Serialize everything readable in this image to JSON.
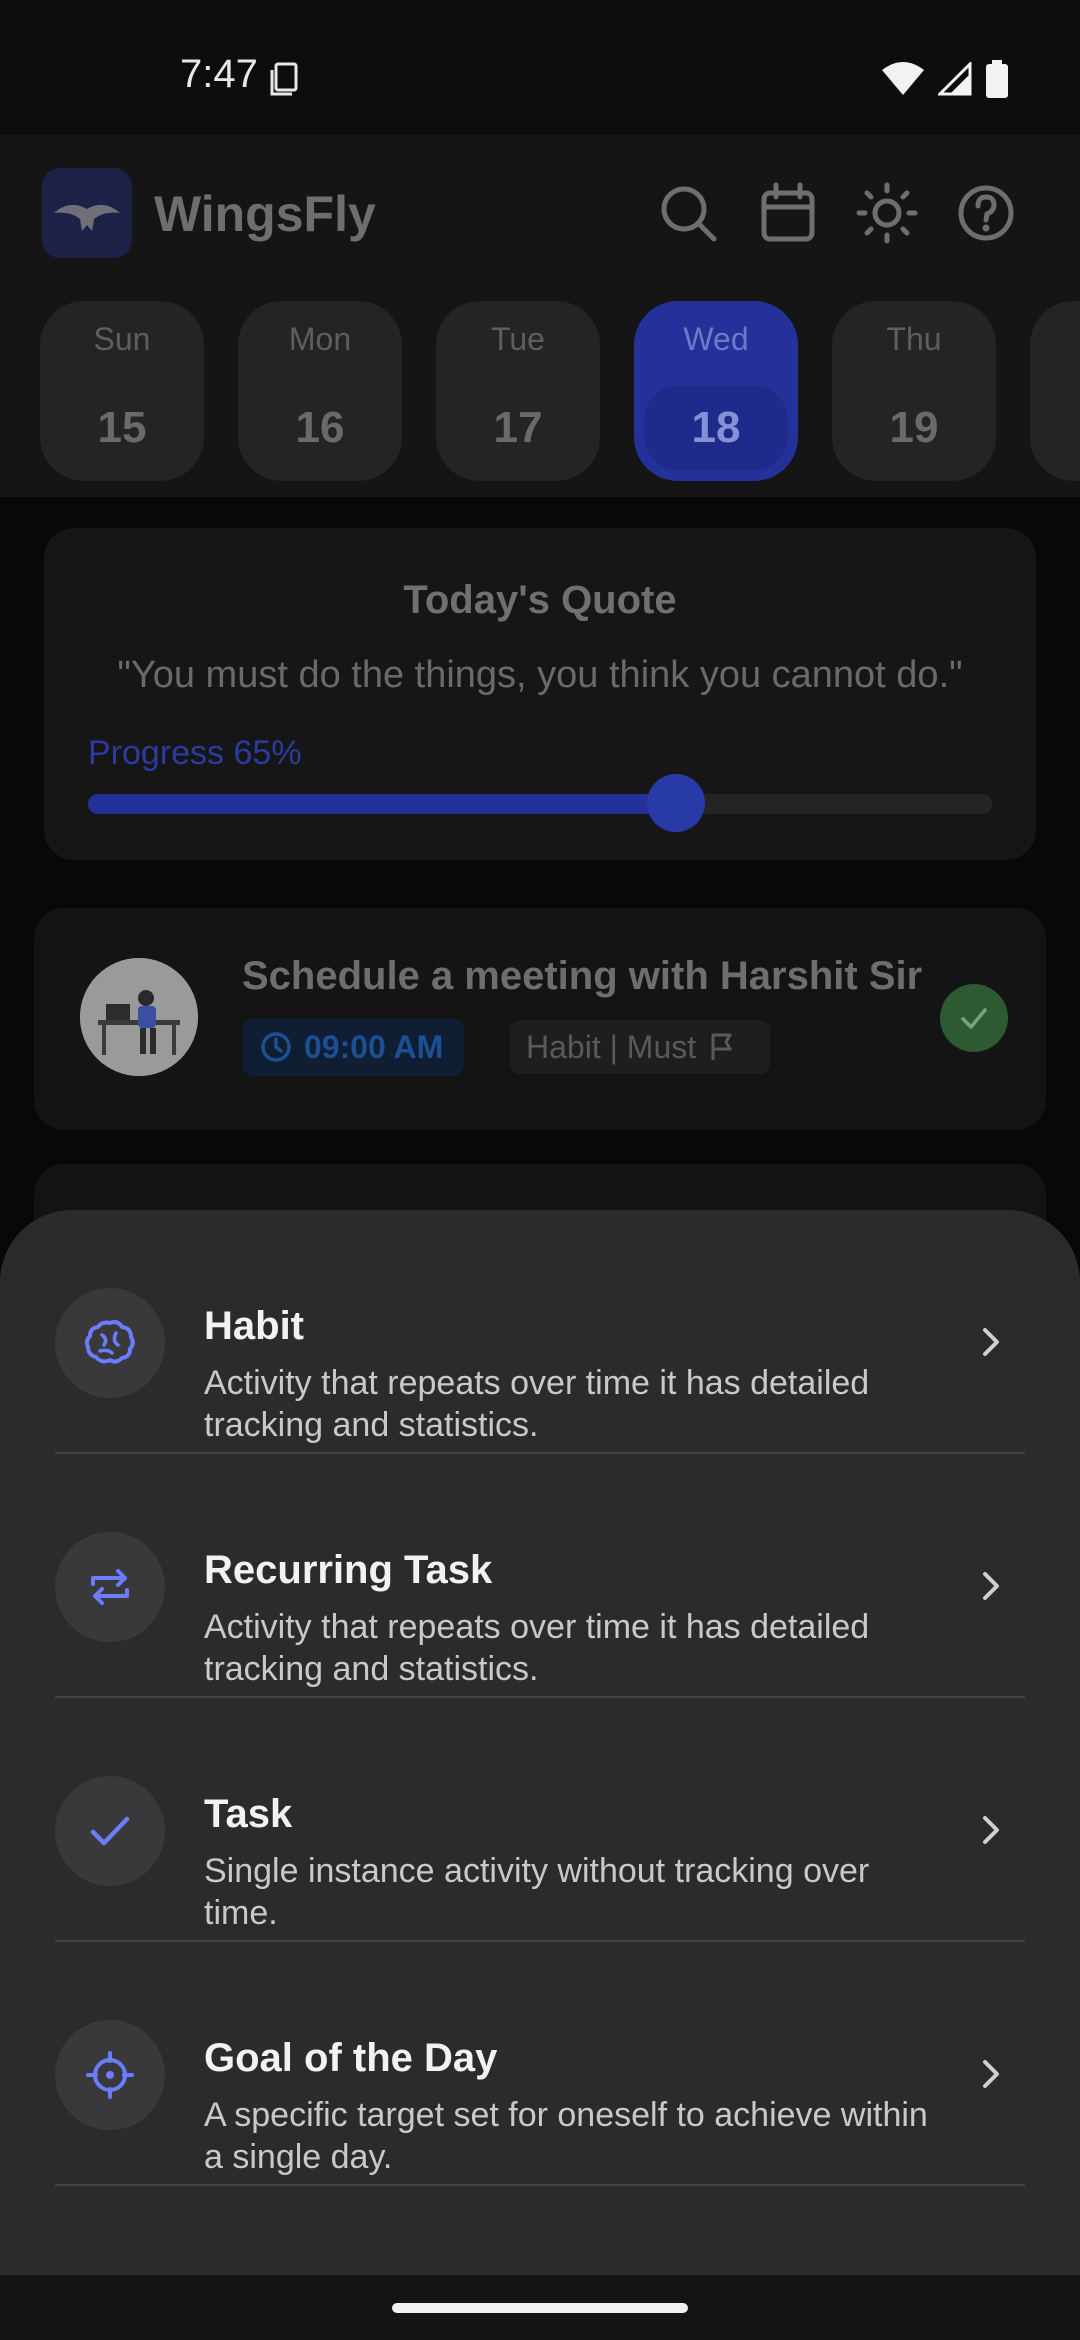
{
  "status_bar": {
    "time": "7:47"
  },
  "header": {
    "app_name": "WingsFly",
    "icons": [
      "search-icon",
      "calendar-icon",
      "brightness-icon",
      "help-icon"
    ]
  },
  "days": [
    {
      "name": "Sun",
      "num": "15",
      "active": false
    },
    {
      "name": "Mon",
      "num": "16",
      "active": false
    },
    {
      "name": "Tue",
      "num": "17",
      "active": false
    },
    {
      "name": "Wed",
      "num": "18",
      "active": true
    },
    {
      "name": "Thu",
      "num": "19",
      "active": false
    }
  ],
  "quote": {
    "title": "Today's Quote",
    "text": "\"You must do the things, you think you cannot do.\"",
    "progress_label": "Progress 65%",
    "progress": 0.65
  },
  "task": {
    "title": "Schedule a meeting with Harshit Sir",
    "time": "09:00 AM",
    "tag": "Habit | Must",
    "completed": true
  },
  "sheet": {
    "options": [
      {
        "title": "Habit",
        "desc": "Activity that repeats over time it has detailed tracking and statistics.",
        "icon": "brain-icon"
      },
      {
        "title": "Recurring Task",
        "desc": "Activity that repeats over time it has detailed tracking and statistics.",
        "icon": "repeat-icon"
      },
      {
        "title": "Task",
        "desc": "Single instance activity without tracking over time.",
        "icon": "check-icon"
      },
      {
        "title": "Goal of the Day",
        "desc": "A specific target set for oneself to achieve within a single day.",
        "icon": "target-icon"
      }
    ]
  },
  "colors": {
    "accent": "#6b7cff",
    "sheet_bg": "#2b2b2d",
    "selected_day": "#24319a",
    "success": "#2e5a31"
  }
}
